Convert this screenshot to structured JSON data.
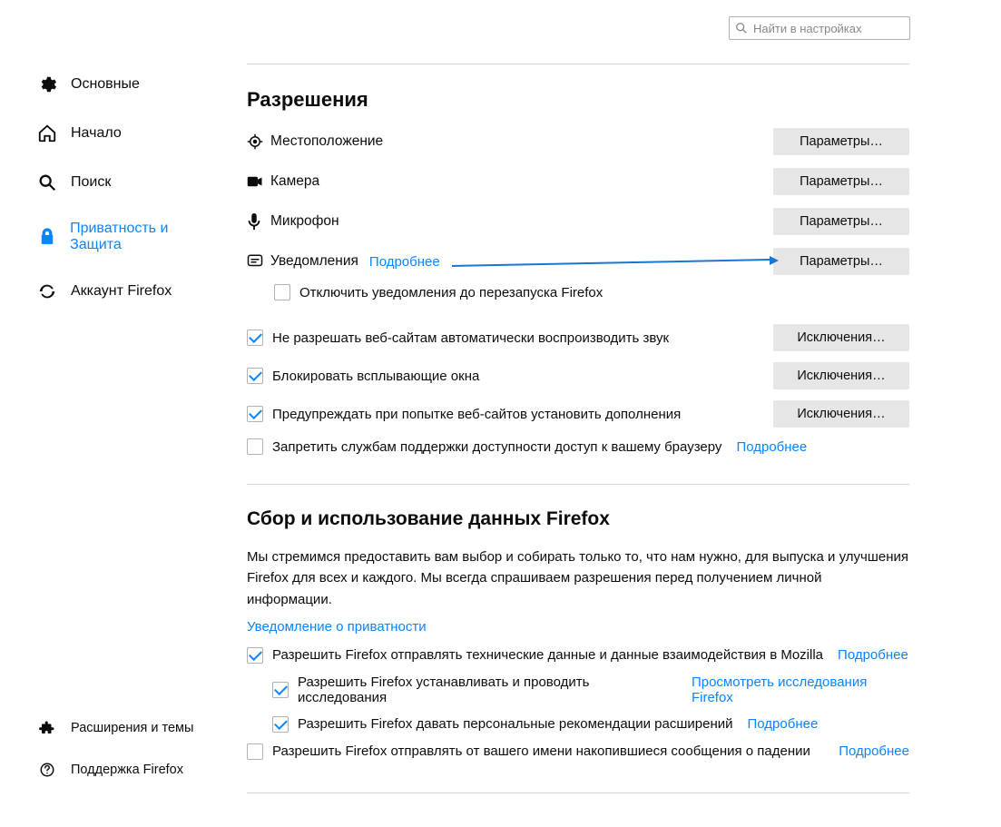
{
  "search": {
    "placeholder": "Найти в настройках"
  },
  "sidebar": {
    "items": [
      {
        "label": "Основные"
      },
      {
        "label": "Начало"
      },
      {
        "label": "Поиск"
      },
      {
        "label": "Приватность и Защита"
      },
      {
        "label": "Аккаунт Firefox"
      }
    ],
    "bottom": [
      {
        "label": "Расширения и темы"
      },
      {
        "label": "Поддержка Firefox"
      }
    ]
  },
  "permissions": {
    "title": "Разрешения",
    "rows": [
      {
        "label": "Местоположение",
        "button": "Параметры…"
      },
      {
        "label": "Камера",
        "button": "Параметры…"
      },
      {
        "label": "Микрофон",
        "button": "Параметры…"
      },
      {
        "label": "Уведомления",
        "link": "Подробнее",
        "button": "Параметры…"
      }
    ],
    "disable_notifications": "Отключить уведомления до перезапуска Firefox",
    "checks": [
      {
        "label": "Не разрешать веб-сайтам автоматически воспроизводить звук",
        "button": "Исключения…",
        "checked": true
      },
      {
        "label": "Блокировать всплывающие окна",
        "button": "Исключения…",
        "checked": true
      },
      {
        "label": "Предупреждать при попытке веб-сайтов установить дополнения",
        "button": "Исключения…",
        "checked": true
      },
      {
        "label": "Запретить службам поддержки доступности доступ к вашему браузеру",
        "link": "Подробнее",
        "checked": false
      }
    ]
  },
  "data": {
    "title": "Сбор и использование данных Firefox",
    "body": "Мы стремимся предоставить вам выбор и собирать только то, что нам нужно, для выпуска и улучшения Firefox для всех и каждого. Мы всегда спрашиваем разрешения перед получением личной информации.",
    "privacy_link": "Уведомление о приватности",
    "checks": [
      {
        "label": "Разрешить Firefox отправлять технические данные и данные взаимодействия в Mozilla",
        "link": "Подробнее",
        "checked": true,
        "indent": 0
      },
      {
        "label": "Разрешить Firefox устанавливать и проводить исследования",
        "link": "Просмотреть исследования Firefox",
        "checked": true,
        "indent": 1
      },
      {
        "label": "Разрешить Firefox давать персональные рекомендации расширений",
        "link": "Подробнее",
        "checked": true,
        "indent": 1
      },
      {
        "label": "Разрешить Firefox отправлять от вашего имени накопившиеся сообщения о падении",
        "link": "Подробнее",
        "checked": false,
        "indent": 0
      }
    ]
  }
}
